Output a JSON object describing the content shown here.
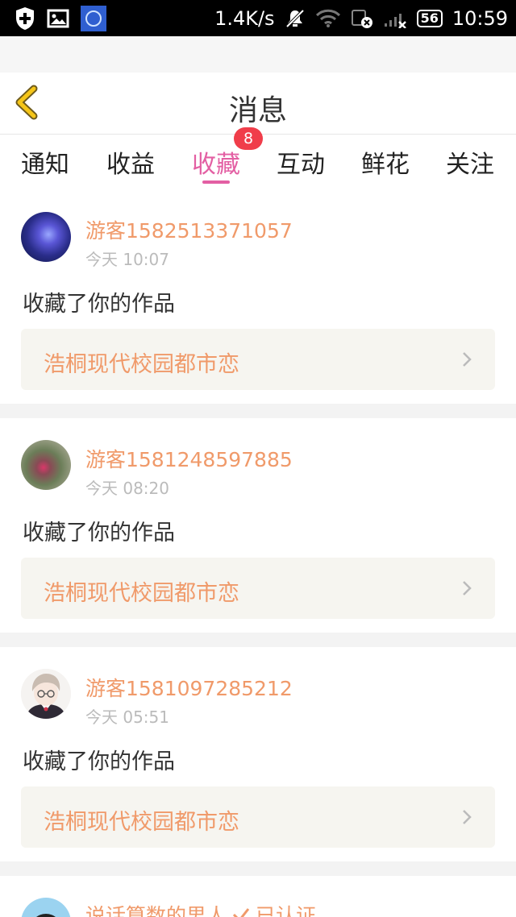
{
  "status_bar": {
    "speed": "1.4K/s",
    "battery": "56",
    "time": "10:59"
  },
  "header": {
    "title": "消息"
  },
  "tabs": [
    {
      "label": "通知"
    },
    {
      "label": "收益"
    },
    {
      "label": "收藏",
      "active": true,
      "badge": "8"
    },
    {
      "label": "互动"
    },
    {
      "label": "鲜花"
    },
    {
      "label": "关注"
    }
  ],
  "messages": [
    {
      "user": "游客1582513371057",
      "time": "今天 10:07",
      "action": "收藏了你的作品",
      "work": "浩桐现代校园都市恋"
    },
    {
      "user": "游客1581248597885",
      "time": "今天 08:20",
      "action": "收藏了你的作品",
      "work": "浩桐现代校园都市恋"
    },
    {
      "user": "游客1581097285212",
      "time": "今天 05:51",
      "action": "收藏了你的作品",
      "work": "浩桐现代校园都市恋"
    },
    {
      "user": "说话算数的男人",
      "verified_label": "已认证"
    }
  ],
  "colors": {
    "accent_pink": "#e35fa3",
    "username_orange": "#f09a6a",
    "badge_red": "#f03d4a",
    "back_arrow_yellow": "#f5c518"
  },
  "icons": [
    "shield-icon",
    "image-icon",
    "app-icon",
    "mute-icon",
    "wifi-icon",
    "sim-icon",
    "signal-icon",
    "battery-icon",
    "back-arrow-icon",
    "chevron-right-icon",
    "verified-check-icon"
  ]
}
